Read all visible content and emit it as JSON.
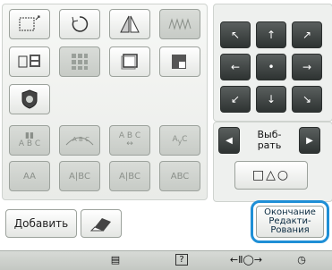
{
  "colors": {
    "accent": "#1f8fd6",
    "dark_button": "#3a3f3e"
  },
  "left_panel": {
    "row1": [
      "resize-icon",
      "rotate-icon",
      "mirror-icon",
      "density-icon"
    ],
    "row2": [
      "array-icon",
      "grid-icon",
      "frame-icon",
      "fill-icon"
    ],
    "row3": [
      "appliqué-icon"
    ],
    "row4": [
      "text-vertical-icon",
      "arc-text-icon",
      "text-spacing-icon",
      "text-curve-icon"
    ],
    "row5_labels": [
      "AA",
      "A|BC",
      "A|BC",
      "ABC"
    ]
  },
  "direction_pad": {
    "arrows": [
      "↖",
      "↑",
      "↗",
      "←",
      "•",
      "→",
      "↙",
      "↓",
      "↘"
    ]
  },
  "select": {
    "label_line1": "Выб-",
    "label_line2": "рать"
  },
  "shapes_label": "□△○",
  "add_button": {
    "label": "Добавить"
  },
  "finish_button": {
    "line1": "Окончание",
    "line2": "Редакти-",
    "line3": "Рования"
  },
  "status_bar": {
    "items": [
      "page-icon",
      "help-icon",
      "size-readout-icon",
      "clock-icon"
    ],
    "size_text": "←Ⅱ◯→"
  }
}
